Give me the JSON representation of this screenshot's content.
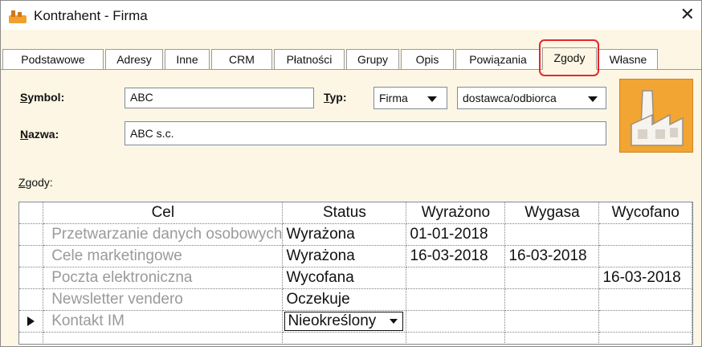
{
  "window": {
    "title": "Kontrahent - Firma",
    "close_glyph": "✕"
  },
  "tabs": [
    {
      "label": "Podstawowe",
      "active": false
    },
    {
      "label": "Adresy",
      "active": false
    },
    {
      "label": "Inne",
      "active": false
    },
    {
      "label": "CRM",
      "active": false
    },
    {
      "label": "Płatności",
      "active": false
    },
    {
      "label": "Grupy",
      "active": false
    },
    {
      "label": "Opis",
      "active": false
    },
    {
      "label": "Powiązania",
      "active": false
    },
    {
      "label": "Zgody",
      "active": true
    },
    {
      "label": "Własne",
      "active": false
    }
  ],
  "form": {
    "symbol_label_first": "S",
    "symbol_label_rest": "ymbol:",
    "symbol_value": "ABC",
    "typ_label_first": "T",
    "typ_label_rest": "yp:",
    "typ_value": "Firma",
    "role_value": "dostawca/odbiorca",
    "nazwa_label_first": "N",
    "nazwa_label_rest": "azwa:",
    "nazwa_value": "ABC s.c."
  },
  "consents": {
    "label_first": "Z",
    "label_rest": "gody:",
    "columns": [
      "Cel",
      "Status",
      "Wyrażono",
      "Wygasa",
      "Wycofano"
    ],
    "rows": [
      {
        "cel": "Przetwarzanie danych osobowych",
        "status": "Wyrażona",
        "wyrazono": "01-01-2018",
        "wygasa": "",
        "wycofano": ""
      },
      {
        "cel": "Cele marketingowe",
        "status": "Wyrażona",
        "wyrazono": "16-03-2018",
        "wygasa": "16-03-2018",
        "wycofano": ""
      },
      {
        "cel": "Poczta elektroniczna",
        "status": "Wycofana",
        "wyrazono": "",
        "wygasa": "",
        "wycofano": "16-03-2018"
      },
      {
        "cel": "Newsletter vendero",
        "status": "Oczekuje",
        "wyrazono": "",
        "wygasa": "",
        "wycofano": ""
      },
      {
        "cel": "Kontakt IM",
        "status": "Nieokreślony",
        "wyrazono": "",
        "wygasa": "",
        "wycofano": ""
      }
    ]
  },
  "colors": {
    "accent_highlight": "#e8262b",
    "panel_bg": "#fdf6e4",
    "icon_bg": "#f2a532"
  }
}
